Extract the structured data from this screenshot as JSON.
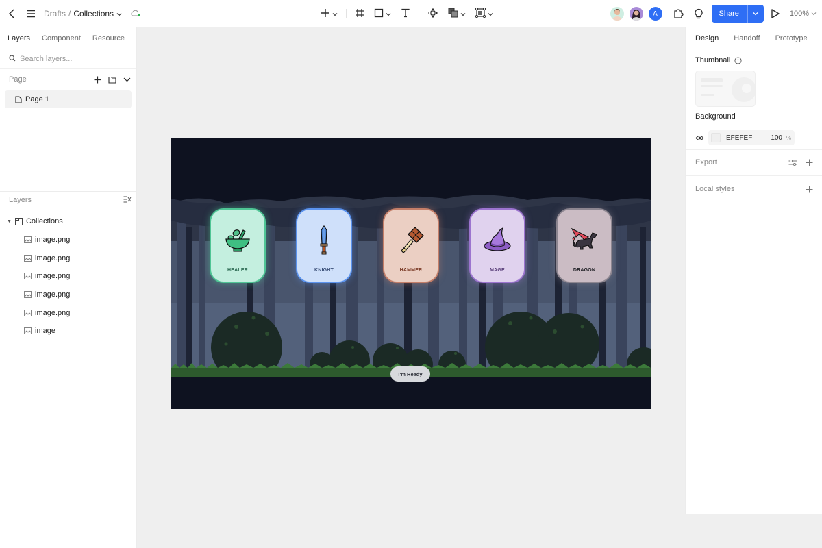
{
  "topbar": {
    "breadcrumb": {
      "parent": "Drafts",
      "separator": "/",
      "current": "Collections"
    },
    "tools": [
      "add",
      "frame",
      "rectangle",
      "text",
      "component",
      "boolean",
      "mask"
    ],
    "avatars": [
      {
        "name": "collaborator-1",
        "initial": ""
      },
      {
        "name": "collaborator-2",
        "initial": ""
      },
      {
        "name": "collaborator-3",
        "initial": "A"
      }
    ],
    "share_label": "Share",
    "zoom_level": "100%"
  },
  "left_panel": {
    "tabs": [
      {
        "label": "Layers",
        "active": true
      },
      {
        "label": "Component",
        "active": false
      },
      {
        "label": "Resource",
        "active": false
      }
    ],
    "search_placeholder": "Search layers...",
    "page_section_title": "Page",
    "pages": [
      {
        "label": "Page 1",
        "selected": true
      }
    ],
    "layers_section_title": "Layers",
    "layers": [
      {
        "label": "Collections",
        "type": "frame",
        "expanded": true
      },
      {
        "label": "image.png",
        "type": "image"
      },
      {
        "label": "image.png",
        "type": "image"
      },
      {
        "label": "image.png",
        "type": "image"
      },
      {
        "label": "image.png",
        "type": "image"
      },
      {
        "label": "image.png",
        "type": "image"
      },
      {
        "label": "image",
        "type": "image"
      }
    ]
  },
  "canvas": {
    "frame_name": "Collections",
    "cards": [
      {
        "label": "HEALER",
        "icon": "mortar-pestle-icon",
        "bg": "#c4efdf",
        "border": "#4fc595",
        "text": "#2d6b53"
      },
      {
        "label": "KNIGHT",
        "icon": "sword-icon",
        "bg": "#cfe0fa",
        "border": "#5b93ee",
        "text": "#3a4f78"
      },
      {
        "label": "HAMMER",
        "icon": "hammer-icon",
        "bg": "#ebcfc3",
        "border": "#c47e68",
        "text": "#7a3a26"
      },
      {
        "label": "MAGE",
        "icon": "wizard-hat-icon",
        "bg": "#e0d2ee",
        "border": "#9c74cf",
        "text": "#5a3f7a"
      },
      {
        "label": "DRAGON",
        "icon": "dragon-icon",
        "bg": "#cbbcc4",
        "border": "#8d8690",
        "text": "#1f1f24"
      }
    ],
    "ready_button_label": "I'm Ready"
  },
  "right_panel": {
    "tabs": [
      {
        "label": "Design",
        "active": true
      },
      {
        "label": "Handoff",
        "active": false
      },
      {
        "label": "Prototype",
        "active": false
      }
    ],
    "thumbnail_title": "Thumbnail",
    "background_title": "Background",
    "background_hex": "EFEFEF",
    "background_opacity": "100",
    "background_opacity_unit": "%",
    "export_title": "Export",
    "local_styles_title": "Local styles"
  },
  "colors": {
    "accent": "#2e6ef5",
    "canvas_bg": "#efefef",
    "frame_bg": "#0e1220"
  }
}
